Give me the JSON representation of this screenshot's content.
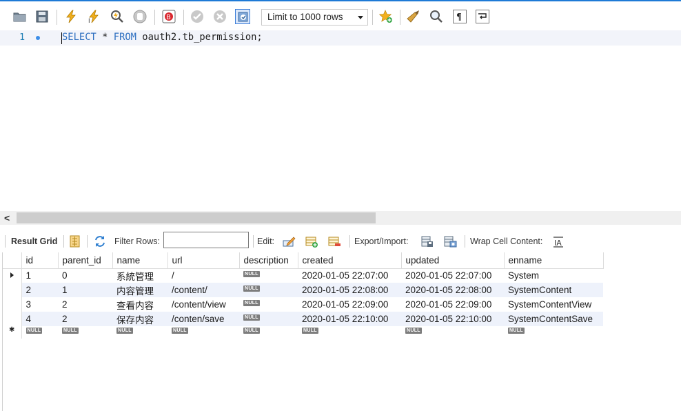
{
  "toolbar": {
    "limit_select_value": "Limit to 1000 rows",
    "icons": [
      "open-folder-icon",
      "save-icon",
      "execute-icon",
      "execute-current-icon",
      "explain-icon",
      "stop-icon",
      "toggle-error-stop-icon",
      "commit-icon",
      "rollback-icon",
      "auto-commit-icon",
      "bookmark-star-icon",
      "beautify-icon",
      "find-icon",
      "invisible-chars-icon",
      "wrap-lines-icon"
    ]
  },
  "editor": {
    "line_number": "1",
    "sql": {
      "select_kw": "SELECT",
      "star": " * ",
      "from_kw": "FROM",
      "rest": " oauth2.tb_permission;"
    }
  },
  "scrollbar": {
    "left_arrow": "<"
  },
  "result_toolbar": {
    "result_grid_label": "Result Grid",
    "filter_rows_label": "Filter Rows:",
    "filter_value": "",
    "edit_label": "Edit:",
    "export_import_label": "Export/Import:",
    "wrap_cell_label": "Wrap Cell Content:",
    "wrap_icon_text": "IA"
  },
  "grid": {
    "null_text": "NULL",
    "columns": [
      "id",
      "parent_id",
      "name",
      "url",
      "description",
      "created",
      "updated",
      "enname"
    ],
    "rows": [
      {
        "id": "1",
        "parent_id": "0",
        "name": "系統管理",
        "url": "/",
        "description": "NULL",
        "created": "2020-01-05 22:07:00",
        "updated": "2020-01-05 22:07:00",
        "enname": "System"
      },
      {
        "id": "2",
        "parent_id": "1",
        "name": "内容管理",
        "url": "/content/",
        "description": "NULL",
        "created": "2020-01-05 22:08:00",
        "updated": "2020-01-05 22:08:00",
        "enname": "SystemContent"
      },
      {
        "id": "3",
        "parent_id": "2",
        "name": "查看内容",
        "url": "/content/view",
        "description": "NULL",
        "created": "2020-01-05 22:09:00",
        "updated": "2020-01-05 22:09:00",
        "enname": "SystemContentView"
      },
      {
        "id": "4",
        "parent_id": "2",
        "name": "保存内容",
        "url": "/conten/save",
        "description": "NULL",
        "created": "2020-01-05 22:10:00",
        "updated": "2020-01-05 22:10:00",
        "enname": "SystemContentSave"
      }
    ],
    "new_row_marker": "✱"
  }
}
